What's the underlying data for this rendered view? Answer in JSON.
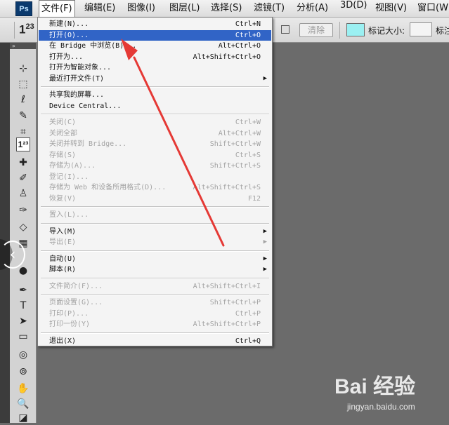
{
  "app": {
    "logo_text": "Ps"
  },
  "menubar": {
    "items": [
      {
        "label": "文件(F)"
      },
      {
        "label": "编辑(E)"
      },
      {
        "label": "图像(I)"
      },
      {
        "label": "图层(L)"
      },
      {
        "label": "选择(S)"
      },
      {
        "label": "滤镜(T)"
      },
      {
        "label": "分析(A)"
      },
      {
        "label": "3D(D)"
      },
      {
        "label": "视图(V)"
      },
      {
        "label": "窗口(W)"
      }
    ]
  },
  "options_bar": {
    "tool_preset": "123",
    "clear_button": "清除",
    "marker_size_label": "标记大小:",
    "truncated_label": "标注"
  },
  "colors": {
    "menu_highlight": "#3164c6",
    "marker_color_swatch": "#9bf0f2",
    "annotation_arrow": "#e53935",
    "canvas_bg": "#6b6b6b"
  },
  "tools_panel": {
    "header": "»",
    "tools": [
      {
        "icon": "move-icon",
        "glyph": "⊹"
      },
      {
        "icon": "marquee-icon",
        "glyph": "⬚"
      },
      {
        "icon": "lasso-icon",
        "glyph": "ℓ"
      },
      {
        "icon": "quick-select-icon",
        "glyph": "✎"
      },
      {
        "icon": "crop-icon",
        "glyph": "⌗"
      },
      {
        "icon": "count-tool-icon",
        "glyph": "1²³",
        "selected": true
      },
      {
        "icon": "healing-brush-icon",
        "glyph": "✚"
      },
      {
        "icon": "brush-icon",
        "glyph": "✐"
      },
      {
        "icon": "clone-stamp-icon",
        "glyph": "♙"
      },
      {
        "icon": "history-brush-icon",
        "glyph": "✑"
      },
      {
        "icon": "eraser-icon",
        "glyph": "◇"
      },
      {
        "icon": "gradient-icon",
        "glyph": "▦"
      },
      {
        "icon": "blur-icon",
        "glyph": "●"
      },
      {
        "icon": "pen-icon",
        "glyph": "✒"
      },
      {
        "icon": "type-icon",
        "glyph": "T"
      },
      {
        "icon": "path-select-icon",
        "glyph": "➤"
      },
      {
        "icon": "shape-icon",
        "glyph": "▭"
      },
      {
        "icon": "3d-rotate-icon",
        "glyph": "◎"
      },
      {
        "icon": "3d-orbit-icon",
        "glyph": "⊚"
      },
      {
        "icon": "hand-icon",
        "glyph": "✋"
      },
      {
        "icon": "zoom-icon",
        "glyph": "🔍"
      },
      {
        "icon": "color-swatches-icon",
        "glyph": "◪"
      }
    ]
  },
  "file_menu": {
    "items": [
      {
        "label": "新建(N)...",
        "shortcut": "Ctrl+N"
      },
      {
        "label": "打开(O)...",
        "shortcut": "Ctrl+O",
        "highlight": true
      },
      {
        "label": "在 Bridge 中浏览(B)...",
        "shortcut": "Alt+Ctrl+O"
      },
      {
        "label": "打开为...",
        "shortcut": "Alt+Shift+Ctrl+O"
      },
      {
        "label": "打开为智能对象...",
        "shortcut": ""
      },
      {
        "label": "最近打开文件(T)",
        "shortcut": "",
        "submenu": true
      },
      {
        "separator": true
      },
      {
        "label": "共享我的屏幕...",
        "shortcut": ""
      },
      {
        "label": "Device Central...",
        "shortcut": ""
      },
      {
        "separator": true
      },
      {
        "label": "关闭(C)",
        "shortcut": "Ctrl+W",
        "disabled": true
      },
      {
        "label": "关闭全部",
        "shortcut": "Alt+Ctrl+W",
        "disabled": true
      },
      {
        "label": "关闭并转到 Bridge...",
        "shortcut": "Shift+Ctrl+W",
        "disabled": true
      },
      {
        "label": "存储(S)",
        "shortcut": "Ctrl+S",
        "disabled": true
      },
      {
        "label": "存储为(A)...",
        "shortcut": "Shift+Ctrl+S",
        "disabled": true
      },
      {
        "label": "登记(I)...",
        "shortcut": "",
        "disabled": true
      },
      {
        "label": "存储为 Web 和设备所用格式(D)...",
        "shortcut": "Alt+Shift+Ctrl+S",
        "disabled": true
      },
      {
        "label": "恢复(V)",
        "shortcut": "F12",
        "disabled": true
      },
      {
        "separator": true
      },
      {
        "label": "置入(L)...",
        "shortcut": "",
        "disabled": true
      },
      {
        "separator": true
      },
      {
        "label": "导入(M)",
        "shortcut": "",
        "submenu": true
      },
      {
        "label": "导出(E)",
        "shortcut": "",
        "submenu": true,
        "disabled": true
      },
      {
        "separator": true
      },
      {
        "label": "自动(U)",
        "shortcut": "",
        "submenu": true
      },
      {
        "label": "脚本(R)",
        "shortcut": "",
        "submenu": true
      },
      {
        "separator": true
      },
      {
        "label": "文件简介(F)...",
        "shortcut": "Alt+Shift+Ctrl+I",
        "disabled": true
      },
      {
        "separator": true
      },
      {
        "label": "页面设置(G)...",
        "shortcut": "Shift+Ctrl+P",
        "disabled": true
      },
      {
        "label": "打印(P)...",
        "shortcut": "Ctrl+P",
        "disabled": true
      },
      {
        "label": "打印一份(Y)",
        "shortcut": "Alt+Shift+Ctrl+P",
        "disabled": true
      },
      {
        "separator": true
      },
      {
        "label": "退出(X)",
        "shortcut": "Ctrl+Q"
      }
    ]
  },
  "watermark": {
    "logo": "Bai  经验",
    "site": "jingyan.baidu.com"
  }
}
